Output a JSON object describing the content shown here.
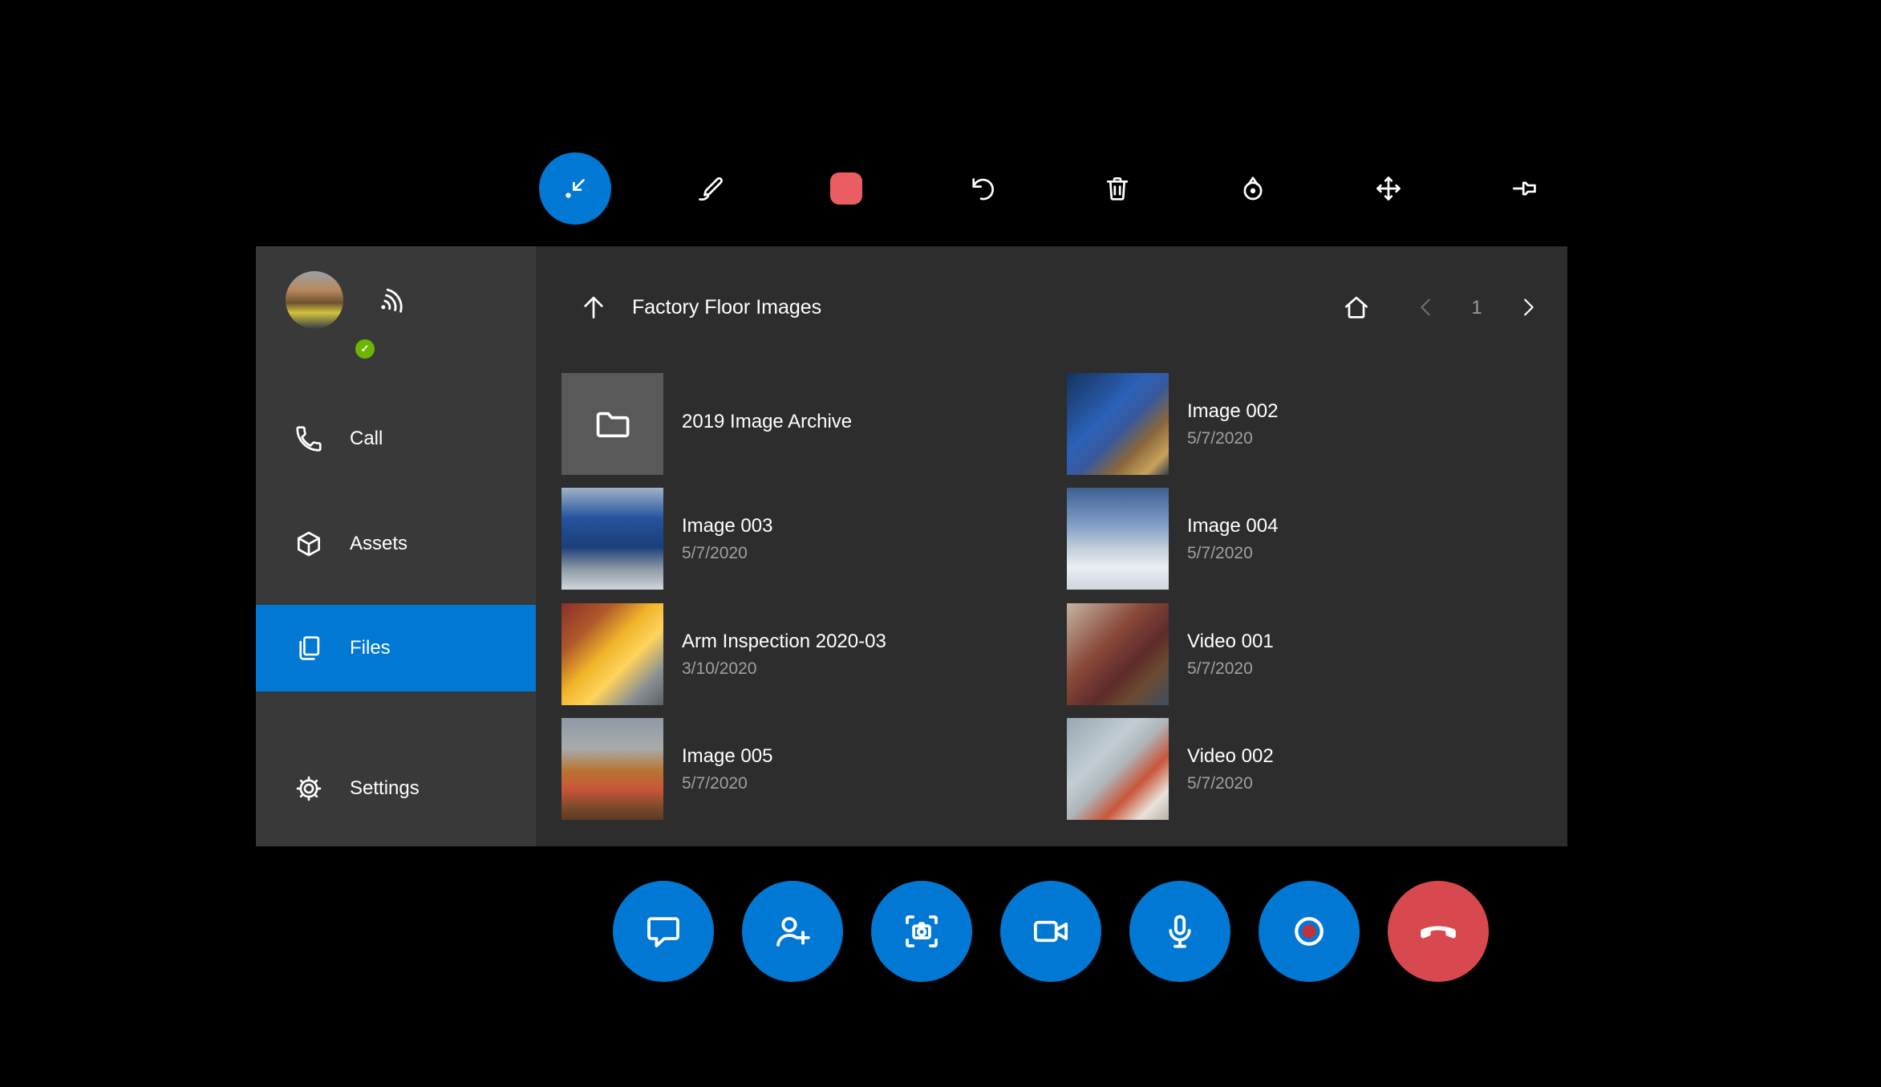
{
  "toolbar": {
    "buttons": [
      {
        "icon": "collapse-toolbar",
        "active": true
      },
      {
        "icon": "ink-pen"
      },
      {
        "icon": "color-swatch",
        "color": "#ea5e63"
      },
      {
        "icon": "undo"
      },
      {
        "icon": "trash"
      },
      {
        "icon": "placement-marker"
      },
      {
        "icon": "move"
      },
      {
        "icon": "pin"
      }
    ]
  },
  "sidebar": {
    "presence": "available",
    "presence_check": "✓",
    "items": [
      {
        "label": "Call"
      },
      {
        "label": "Assets"
      },
      {
        "label": "Files",
        "selected": true
      },
      {
        "label": "Settings"
      }
    ]
  },
  "content": {
    "title": "Factory Floor Images",
    "page": "1",
    "nav_icons": [
      "up-arrow",
      "home",
      "chevron-left",
      "chevron-right"
    ]
  },
  "files": {
    "items": [
      {
        "name": "2019 Image Archive",
        "date": "",
        "type": "folder"
      },
      {
        "name": "Image 002",
        "date": "5/7/2020",
        "type": "image"
      },
      {
        "name": "Image 003",
        "date": "5/7/2020",
        "type": "image"
      },
      {
        "name": "Image 004",
        "date": "5/7/2020",
        "type": "image"
      },
      {
        "name": "Arm Inspection 2020-03",
        "date": "3/10/2020",
        "type": "image"
      },
      {
        "name": "Video 001",
        "date": "5/7/2020",
        "type": "video"
      },
      {
        "name": "Image 005",
        "date": "5/7/2020",
        "type": "image"
      },
      {
        "name": "Video 002",
        "date": "5/7/2020",
        "type": "video"
      }
    ]
  },
  "call_bar": {
    "buttons": [
      {
        "icon": "chat"
      },
      {
        "icon": "add-participant"
      },
      {
        "icon": "photo-capture"
      },
      {
        "icon": "video-camera"
      },
      {
        "icon": "microphone"
      },
      {
        "icon": "record",
        "dot_color": "#c4313b"
      },
      {
        "icon": "hang-up",
        "color": "#d8494f"
      }
    ]
  },
  "colors": {
    "accent": "#0078d4",
    "hangup": "#d8494f",
    "record_dot": "#c4313b",
    "swatch": "#ea5e63",
    "presence_available": "#6bb700"
  }
}
